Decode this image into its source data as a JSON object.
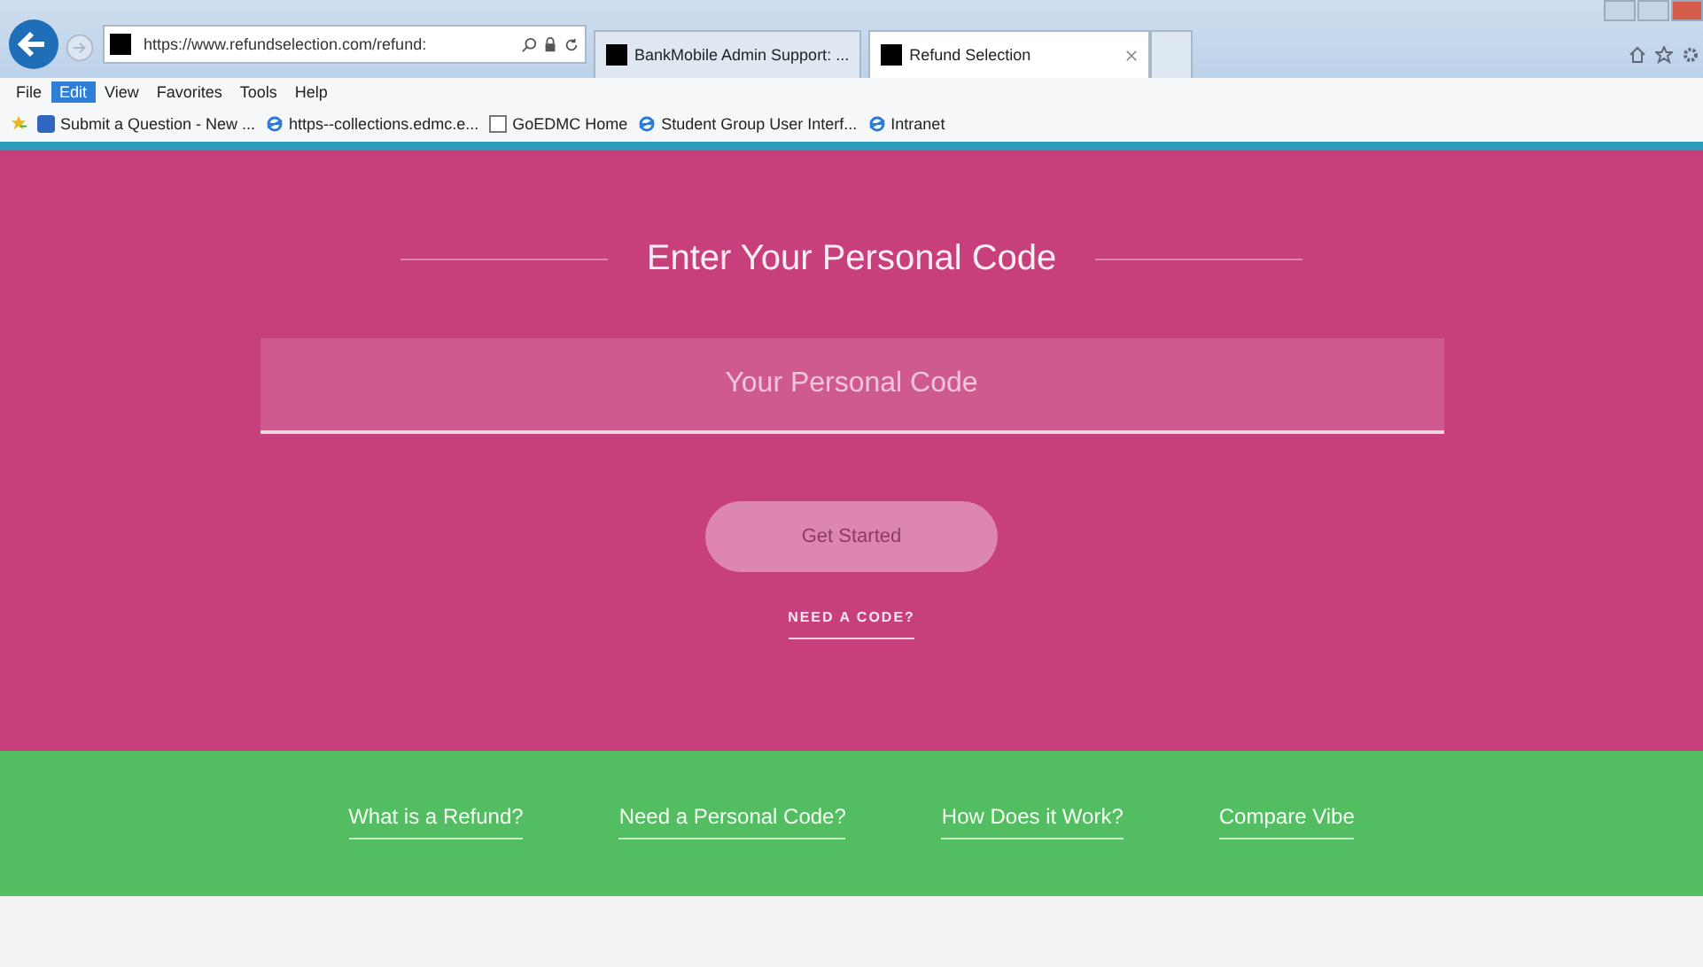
{
  "browser": {
    "url": "https://www.refundselection.com/refund:",
    "tabs": [
      {
        "label": "BankMobile Admin Support: ...",
        "selected": false
      },
      {
        "label": "Refund Selection",
        "selected": true
      }
    ],
    "menu": [
      {
        "label": "File",
        "selected": false
      },
      {
        "label": "Edit",
        "selected": true
      },
      {
        "label": "View",
        "selected": false
      },
      {
        "label": "Favorites",
        "selected": false
      },
      {
        "label": "Tools",
        "selected": false
      },
      {
        "label": "Help",
        "selected": false
      }
    ],
    "favorites": [
      {
        "label": "Submit a Question - New ...",
        "kind": "app"
      },
      {
        "label": "https--collections.edmc.e...",
        "kind": "ie"
      },
      {
        "label": "GoEDMC Home",
        "kind": "page"
      },
      {
        "label": "Student Group User Interf...",
        "kind": "ie"
      },
      {
        "label": "Intranet",
        "kind": "ie"
      }
    ]
  },
  "hero": {
    "title": "Enter Your Personal Code",
    "field": {
      "placeholder": "Your Personal Code"
    },
    "button": "Get Started",
    "link": "NEED A CODE?"
  },
  "footer_links": [
    "What is a Refund?",
    "Need a Personal Code?",
    "How Does it Work?",
    "Compare Vibe"
  ]
}
